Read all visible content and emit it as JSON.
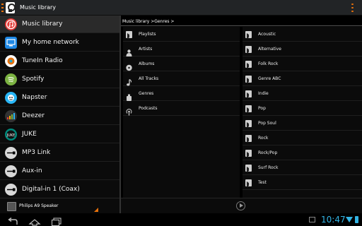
{
  "app": {
    "title": "Music library"
  },
  "sidebar": {
    "items": [
      {
        "label": "Music library",
        "icon": "music-library-icon",
        "color": "#e53935",
        "selected": true
      },
      {
        "label": "My home network",
        "icon": "network-icon",
        "color": "#1e88e5"
      },
      {
        "label": "TuneIn Radio",
        "icon": "tunein-icon",
        "color": "#ffffff"
      },
      {
        "label": "Spotify",
        "icon": "spotify-icon",
        "color": "#7cb342"
      },
      {
        "label": "Napster",
        "icon": "napster-icon",
        "color": "#29b6f6"
      },
      {
        "label": "Deezer",
        "icon": "deezer-icon",
        "color": "#e53935"
      },
      {
        "label": "JUKE",
        "icon": "juke-icon",
        "color": "#00897b"
      },
      {
        "label": "MP3 Link",
        "icon": "mp3-link-icon",
        "color": "#d9d9d9"
      },
      {
        "label": "Aux-in",
        "icon": "aux-in-icon",
        "color": "#d9d9d9"
      },
      {
        "label": "Digital-in 1 (Coax)",
        "icon": "digital-in-icon",
        "color": "#d9d9d9"
      }
    ],
    "footer": {
      "speaker": "Philips A9 Speaker"
    }
  },
  "breadcrumb": "Music library >Genres >",
  "categories": [
    {
      "label": "Playlists",
      "icon": "playlist-icon"
    },
    {
      "label": "Artists",
      "icon": "artist-icon"
    },
    {
      "label": "Albums",
      "icon": "album-icon"
    },
    {
      "label": "All Tracks",
      "icon": "track-icon"
    },
    {
      "label": "Genres",
      "icon": "genre-icon"
    },
    {
      "label": "Podcasts",
      "icon": "podcast-icon"
    }
  ],
  "genres": [
    "Acoustic",
    "Alternative",
    "Folk Rock",
    "Genre ABC",
    "Indie",
    "Pop",
    "Pop Soul",
    "Rock",
    "Rock/Pop",
    "Surf Rock",
    "Test"
  ],
  "system": {
    "time": "10:47"
  },
  "colors": {
    "accent": "#e8710a",
    "status": "#33b5e5"
  }
}
